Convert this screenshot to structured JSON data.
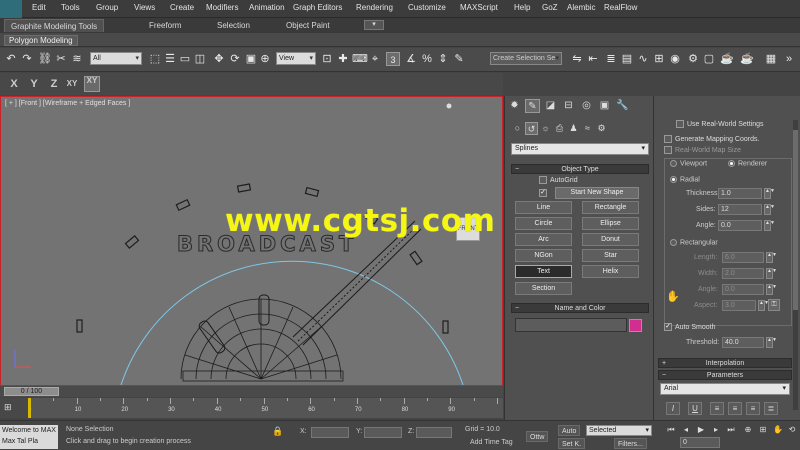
{
  "menu": [
    "Edit",
    "Tools",
    "Group",
    "Views",
    "Create",
    "Modifiers",
    "Animation",
    "Graph Editors",
    "Rendering",
    "Customize",
    "MAXScript",
    "Help",
    "GoZ",
    "Alembic",
    "RealFlow"
  ],
  "ribbon": {
    "tabs": [
      "Graphite Modeling Tools",
      "Freeform",
      "Selection",
      "Object Paint"
    ],
    "panel_label": "Polygon Modeling"
  },
  "toolbar": {
    "filter_value": "All",
    "refcoord_value": "View",
    "snap_value": "3",
    "selection_set_placeholder": "Create Selection Se"
  },
  "axis": {
    "x": "X",
    "y": "Y",
    "z": "Z",
    "xy": "XY",
    "xy_active": "XY"
  },
  "viewport": {
    "label": "[ + ] [Front ] [Wireframe + Edged Faces ]",
    "scene_text": "BROADCAST",
    "viewcube_label": "FRONT"
  },
  "watermark": "www.cgtsj.com",
  "timeline": {
    "frame_label": "0 / 100",
    "ticks": [
      "0",
      "10",
      "20",
      "30",
      "40",
      "50",
      "60",
      "70",
      "80",
      "90"
    ]
  },
  "status": {
    "maxscript": "Welcome to MAX",
    "maxscript_line2": "Max   Tal   Pla",
    "prompt_line1": "None Selection",
    "prompt_line2": "Click and drag to begin creation process",
    "x_label": "X:",
    "y_label": "Y:",
    "z_label": "Z:",
    "grid": "Grid = 10.0",
    "add_time_tag": "Add Time Tag",
    "auto": "Auto",
    "selected": "Selected",
    "setk": "Set K.",
    "filters": "Filters...",
    "frame_value": "0",
    "cmd": "Ottw"
  },
  "command_panel": {
    "category_value": "Splines",
    "object_type_title": "Object Type",
    "autogrid": "AutoGrid",
    "start_new_shape": "Start New Shape",
    "buttons": [
      "Line",
      "Rectangle",
      "Circle",
      "Ellipse",
      "Arc",
      "Donut",
      "NGon",
      "Star",
      "Text",
      "Helix",
      "Section"
    ],
    "name_color_title": "Name and Color"
  },
  "parameters": {
    "use_world_cap": "Use Real-World Settings",
    "gen_mapping": "Generate Mapping Coords.",
    "real_world": "Real-World Map Size",
    "viewport": "Viewport",
    "renderer": "Renderer",
    "radial": "Radial",
    "thickness_label": "Thickness:",
    "thickness_value": "1.0",
    "sides_label": "Sides:",
    "sides_value": "12",
    "angle_label": "Angle:",
    "angle_value": "0.0",
    "rectangular": "Rectangular",
    "length_label": "Length:",
    "length_value": "6.0",
    "width_label": "Width:",
    "width_value": "2.0",
    "angle2_label": "Angle:",
    "angle2_value": "0.0",
    "aspect_label": "Aspect:",
    "aspect_value": "3.0",
    "auto_smooth": "Auto Smooth",
    "threshold_label": "Threshold:",
    "threshold_value": "40.0",
    "interpolation_title": "Interpolation",
    "parameters_title": "Parameters",
    "font_value": "Arial"
  },
  "colors": {
    "viewport_border": "#c8232a",
    "watermark": "#f6f614",
    "swatch": "#d12f8f",
    "arc": "#7fc6e6"
  }
}
